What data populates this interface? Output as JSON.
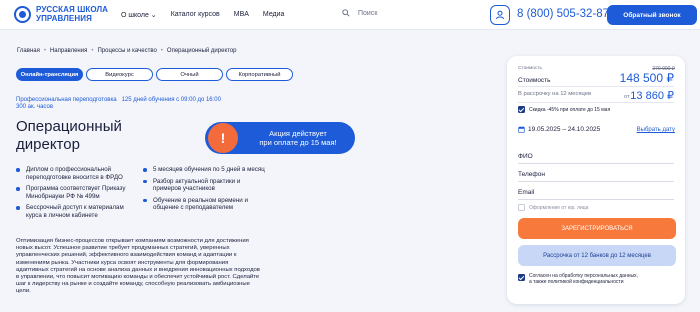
{
  "header": {
    "logo_line1": "РУССКАЯ ШКОЛА",
    "logo_line2": "УПРАВЛЕНИЯ",
    "nav": [
      "О школе ⌄",
      "Каталог курсов",
      "MBA",
      "Медиа"
    ],
    "search_placeholder": "Поиск",
    "phone": "8 (800) 505-32-87",
    "callback_label": "Обратный звонок"
  },
  "breadcrumbs": [
    "Главная",
    "Направления",
    "Процессы и качество",
    "Операционный директор"
  ],
  "formats": [
    {
      "label": "Онлайн-трансляция",
      "active": true
    },
    {
      "label": "Видеокурс",
      "active": false
    },
    {
      "label": "Очный",
      "active": false
    },
    {
      "label": "Корпоративный",
      "active": false
    }
  ],
  "meta": {
    "type": "Профессиональная переподготовка",
    "schedule": "125 дней обучения с 09:00 до 16:00",
    "hours": "300 ак. часов"
  },
  "title_line1": "Операционный",
  "title_line2": "директор",
  "promo": {
    "icon": "!",
    "line1": "Акция действует",
    "line2": "при оплате до 15 мая!"
  },
  "features_left": [
    "Диплом о профессиональной переподготовке вносится в ФРДО",
    "Программа соответствует Приказу Минобрнауки РФ № 499м",
    "Бессрочный доступ к материалам курса в личном кабинете"
  ],
  "features_right": [
    "5 месяцев обучения по 5 дней в месяц",
    "Разбор актуальной практики и примеров участников",
    "Обучение в реальном времени и общение с преподавателем"
  ],
  "description": "Оптимизация бизнес-процессов открывает компаниям возможности для достижения новых высот. Успешное развитие требует продуманных стратегий, уверенных управленческих решений, эффективного взаимодействия команд и адаптации к изменениям рынка. Участники курса освоят инструменты для формирования адаптивных стратегий на основе анализа данных и внедрения инновационных подходов в управлении, что повысит мотивацию команды и обеспечит устойчивый рост. Сделайте шаг к лидерству на рынке и создайте команду, способную реализовать амбициозные цели.",
  "card": {
    "cost_small": "Стоимость",
    "old_price": "270 000 ₽",
    "cost_label": "Стоимость",
    "price": "148 500 ₽",
    "installment_label": "В рассрочку на 12 месяцев",
    "installment_from": "от",
    "installment_price": "13 860 ₽",
    "discount_text": "Скидка -45% при оплате до 15 мая",
    "dates": "19.05.2025 – 24.10.2025",
    "choose_date": "Выбрать дату",
    "field_name": "ФИО",
    "field_phone": "Телефон",
    "field_email": "Email",
    "legal_entity": "Оформление от юр. лица",
    "register_label": "ЗАРЕГИСТРИРОВАТЬСЯ",
    "installment_button": "Рассрочка от 12 банков до 12 месяцев",
    "consent_line1": "Согласен на обработку персональных данных,",
    "consent_line2": "а также политикой конфиденциальности"
  },
  "colors": {
    "accent": "#1e5bd8",
    "cta": "#f7793c",
    "promo_icon": "#f36b3b",
    "background": "#f3f5fa"
  }
}
